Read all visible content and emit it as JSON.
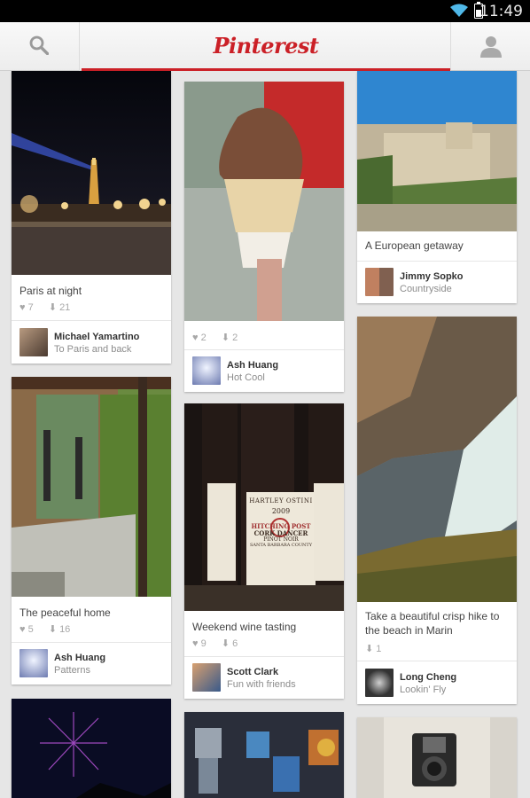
{
  "status_bar": {
    "time": "11:49"
  },
  "header": {
    "logo": "Pinterest",
    "search_icon": "search-icon",
    "profile_icon": "person-icon"
  },
  "pins": [
    {
      "caption": "Paris at night",
      "likes": "7",
      "repins": "21",
      "user": "Michael Yamartino",
      "board": "To Paris and back"
    },
    {
      "caption": "",
      "likes": "2",
      "repins": "2",
      "user": "Ash Huang",
      "board": "Hot Cool"
    },
    {
      "caption": "A European getaway",
      "likes": "",
      "repins": "",
      "user": "Jimmy Sopko",
      "board": "Countryside"
    },
    {
      "caption": "The peaceful home",
      "likes": "5",
      "repins": "16",
      "user": "Ash Huang",
      "board": "Patterns"
    },
    {
      "caption": "Weekend wine tasting",
      "likes": "9",
      "repins": "6",
      "user": "Scott Clark",
      "board": "Fun with friends"
    },
    {
      "caption": "Take a beautiful crisp hike to the beach in Marin",
      "likes": "",
      "repins": "1",
      "user": "Long Cheng",
      "board": "Lookin' Fly"
    }
  ],
  "wine_labels": {
    "brand": "HARTLEY OSTINI",
    "name": "HITCHING POST",
    "vintage": "2009",
    "wine": "CORK DANCER",
    "varietal": "PINOT NOIR",
    "region": "SANTA BARBARA COUNTY"
  },
  "icons": {
    "like": "heart-icon",
    "repin": "pushpin-icon"
  },
  "colors": {
    "brand_red": "#cb2027",
    "background": "#e6e6e6"
  }
}
